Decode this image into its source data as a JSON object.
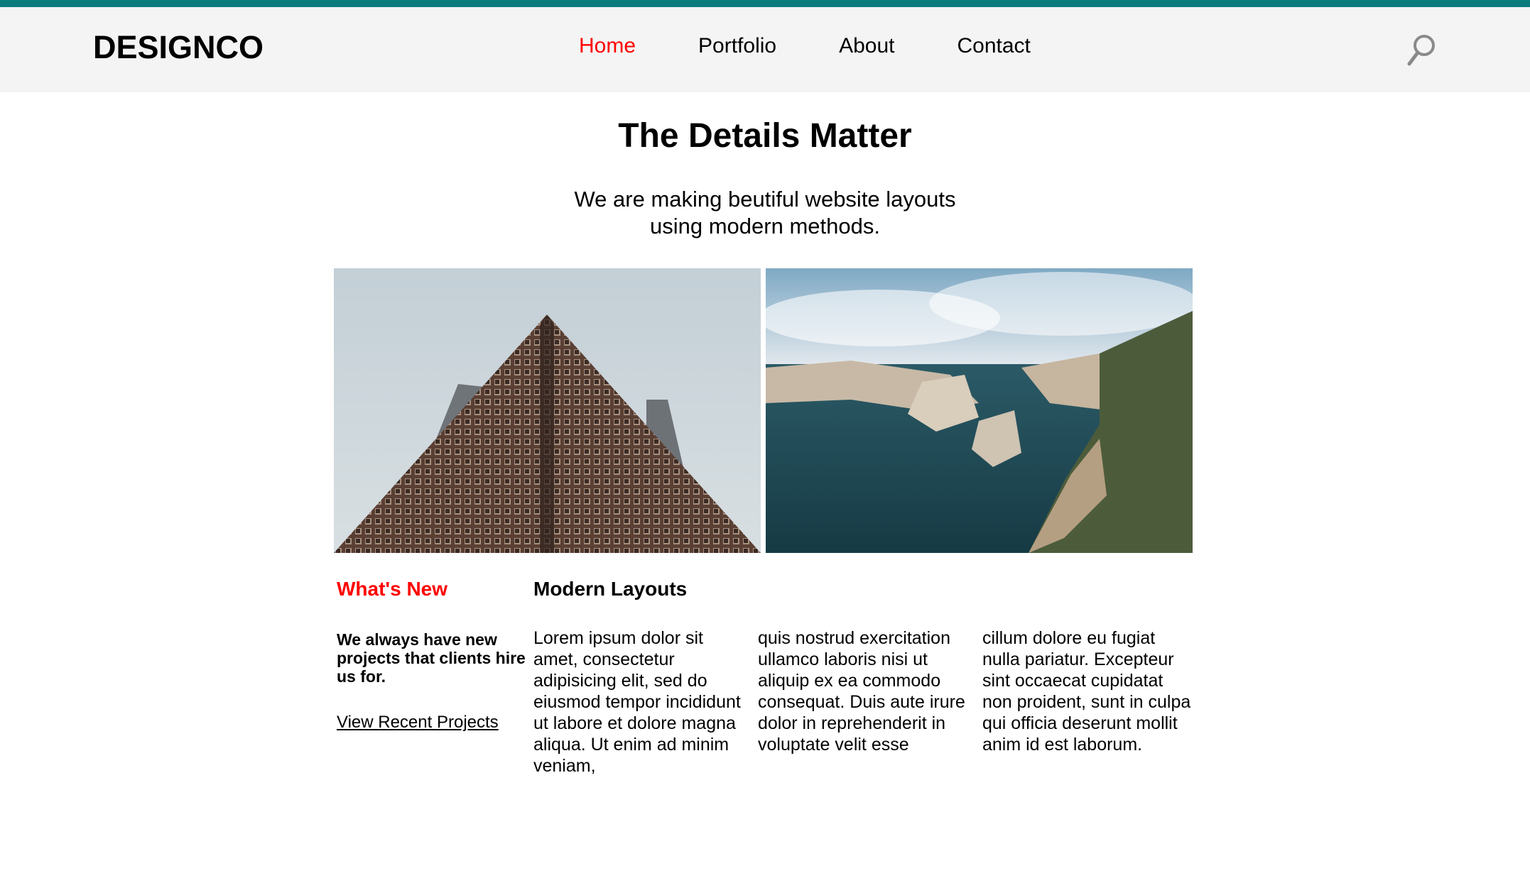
{
  "header": {
    "logo": "DESIGNCO",
    "nav": [
      "Home",
      "Portfolio",
      "About",
      "Contact"
    ],
    "active_nav": "Home"
  },
  "hero": {
    "title": "The Details Matter",
    "subtitle": "We are making beutiful website layouts using modern methods."
  },
  "images": {
    "left": "building-photo",
    "right": "coastal-cliffs-photo"
  },
  "sidebar": {
    "heading": "What's New",
    "blurb": "We always have new projects that clients hire us for.",
    "link": "View Recent Projects"
  },
  "article": {
    "heading": "Modern Layouts",
    "columns": [
      "Lorem ipsum dolor sit amet, consectetur adipisicing elit, sed do eiusmod tempor incididunt ut labore et dolore magna aliqua. Ut enim ad minim veniam,",
      "quis nostrud exercitation ullamco laboris nisi ut aliquip ex ea commodo consequat. Duis aute irure dolor in reprehenderit in voluptate velit esse",
      "cillum dolore eu fugiat nulla pariatur. Excepteur sint occaecat cupidatat non proident, sunt in culpa qui officia deserunt mollit anim id est laborum."
    ]
  },
  "colors": {
    "top_strip": "#0b7b7e",
    "header_bg": "#f4f4f4",
    "accent": "#ff0000"
  }
}
